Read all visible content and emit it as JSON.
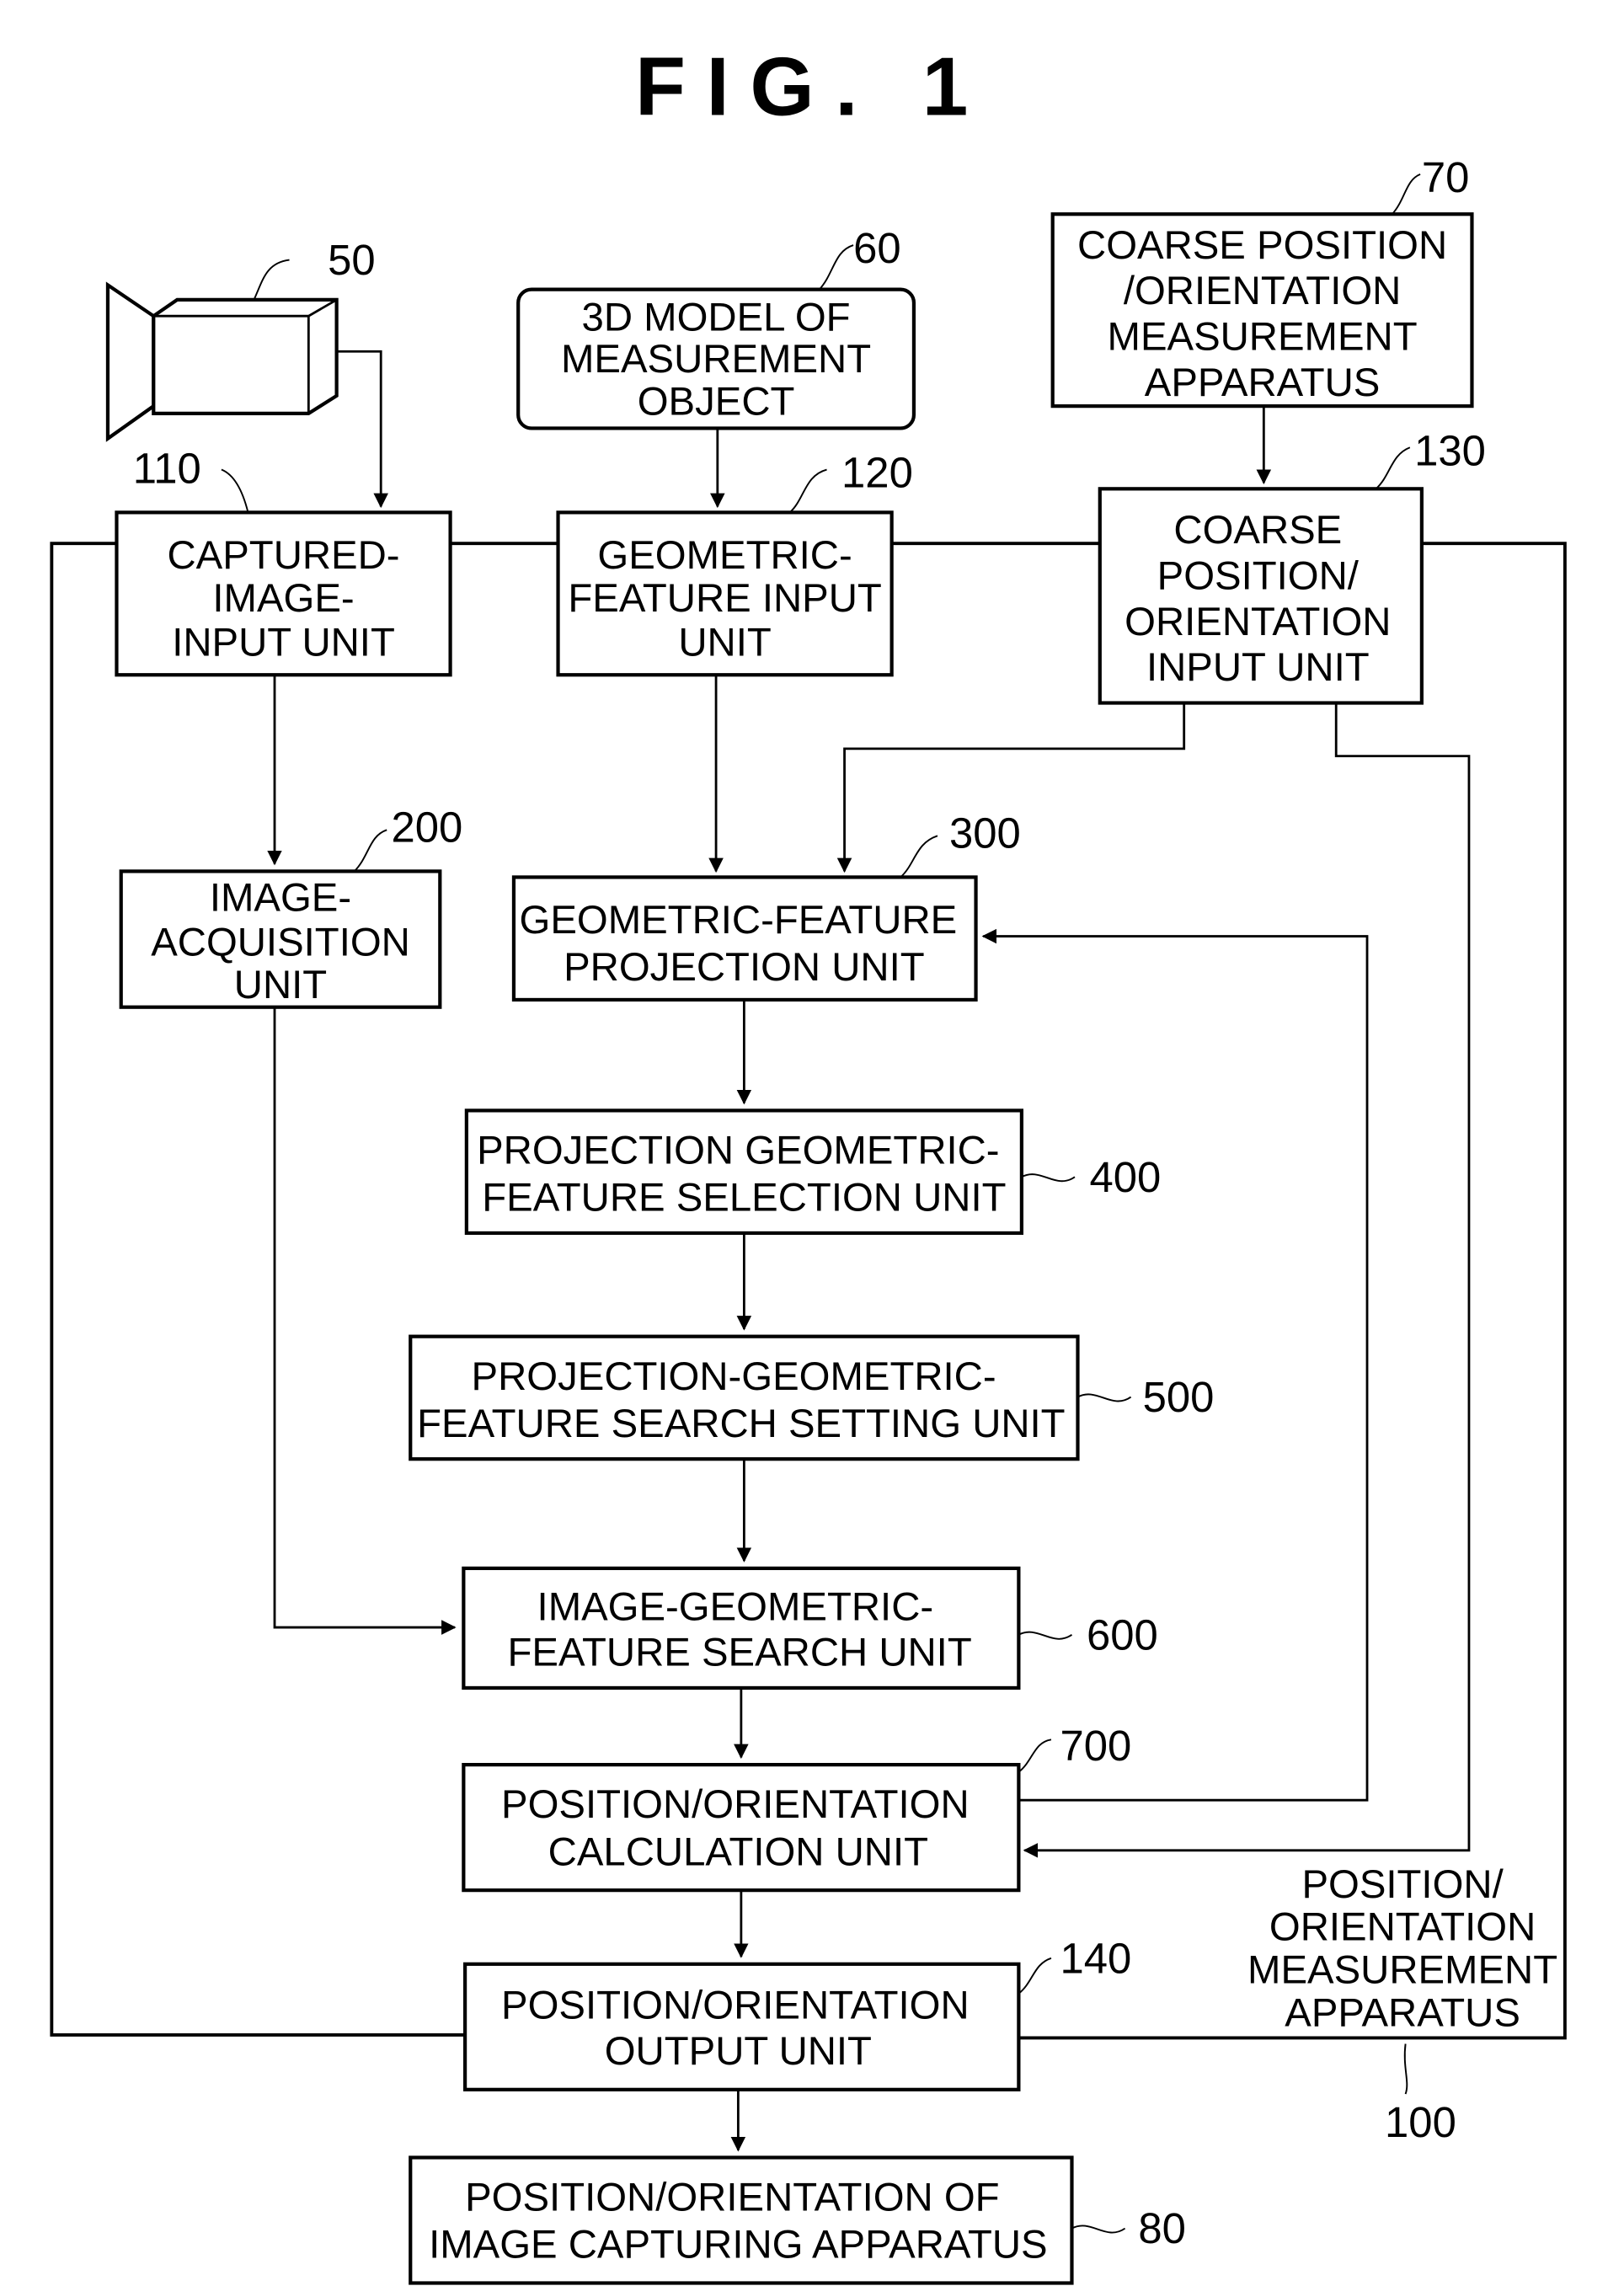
{
  "title": "FIG. 1",
  "apparatus": {
    "label_lines": [
      "POSITION/",
      "ORIENTATION",
      "MEASUREMENT",
      "APPARATUS"
    ],
    "ref": "100"
  },
  "external": {
    "camera": {
      "ref": "50"
    },
    "model": {
      "ref": "60",
      "lines": [
        "3D MODEL OF",
        "MEASUREMENT",
        "OBJECT"
      ]
    },
    "coarse_apparatus": {
      "ref": "70",
      "lines": [
        "COARSE POSITION",
        "/ORIENTATION",
        "MEASUREMENT",
        "APPARATUS"
      ]
    },
    "output": {
      "ref": "80",
      "lines": [
        "POSITION/ORIENTATION OF",
        "IMAGE CAPTURING APPARATUS"
      ]
    }
  },
  "units": {
    "captured_image_input": {
      "ref": "110",
      "lines": [
        "CAPTURED-",
        "IMAGE-",
        "INPUT UNIT"
      ]
    },
    "geometric_feature_input": {
      "ref": "120",
      "lines": [
        "GEOMETRIC-",
        "FEATURE INPUT",
        "UNIT"
      ]
    },
    "coarse_input": {
      "ref": "130",
      "lines": [
        "COARSE",
        "POSITION/",
        "ORIENTATION",
        "INPUT UNIT"
      ]
    },
    "image_acquisition": {
      "ref": "200",
      "lines": [
        "IMAGE-",
        "ACQUISITION",
        "UNIT"
      ]
    },
    "projection": {
      "ref": "300",
      "lines": [
        "GEOMETRIC-FEATURE",
        "PROJECTION UNIT"
      ]
    },
    "selection": {
      "ref": "400",
      "lines": [
        "PROJECTION GEOMETRIC-",
        "FEATURE SELECTION UNIT"
      ]
    },
    "search_setting": {
      "ref": "500",
      "lines": [
        "PROJECTION-GEOMETRIC-",
        "FEATURE SEARCH SETTING UNIT"
      ]
    },
    "image_search": {
      "ref": "600",
      "lines": [
        "IMAGE-GEOMETRIC-",
        "FEATURE SEARCH UNIT"
      ]
    },
    "calculation": {
      "ref": "700",
      "lines": [
        "POSITION/ORIENTATION",
        "CALCULATION UNIT"
      ]
    },
    "output_unit": {
      "ref": "140",
      "lines": [
        "POSITION/ORIENTATION",
        "OUTPUT UNIT"
      ]
    }
  }
}
